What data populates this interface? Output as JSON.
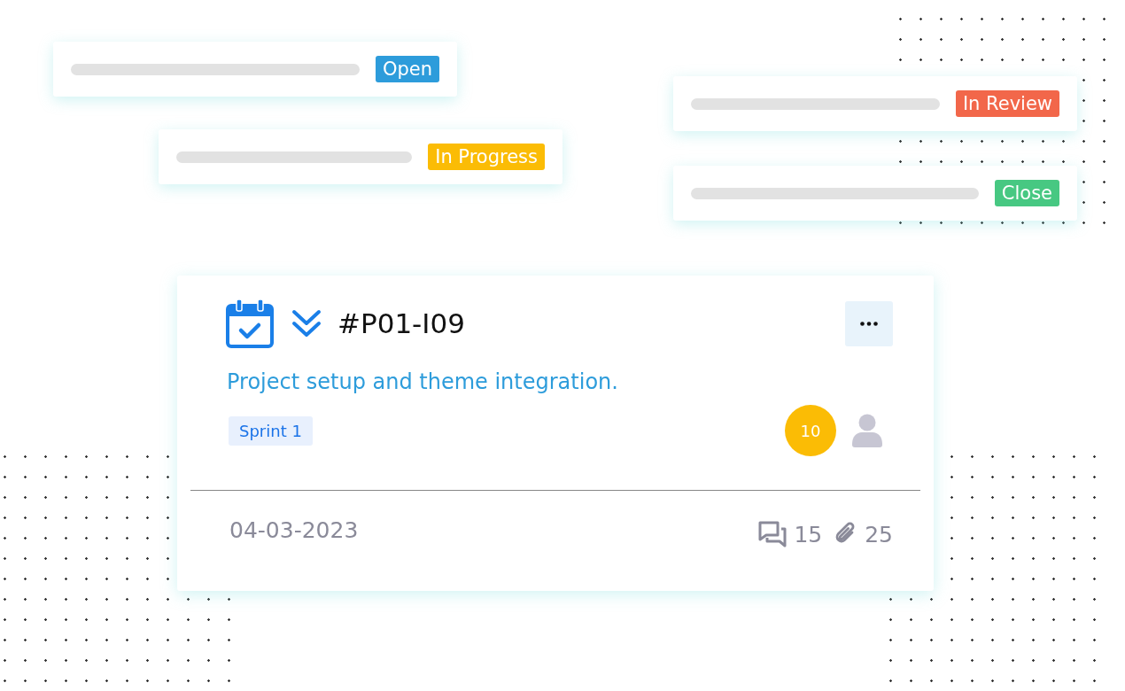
{
  "status_cards": [
    {
      "label": "Open",
      "color": "#2d9cdb"
    },
    {
      "label": "In Progress",
      "color": "#fbbc05"
    },
    {
      "label": "In Review",
      "color": "#f2674a"
    },
    {
      "label": "Close",
      "color": "#47c882"
    }
  ],
  "task_card": {
    "id": "#P01-I09",
    "title": "Project setup and theme integration.",
    "tag": "Sprint 1",
    "points": "10",
    "date": "04-03-2023",
    "comments": "15",
    "attachments": "25"
  }
}
